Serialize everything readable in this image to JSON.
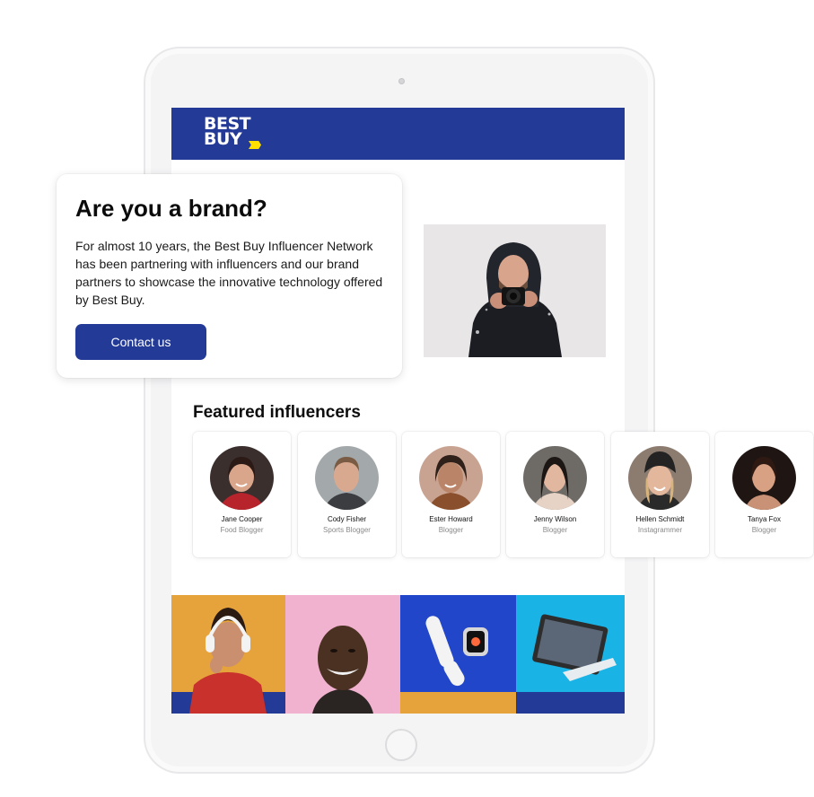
{
  "header": {
    "logo_line1": "BEST",
    "logo_line2": "BUY"
  },
  "brand_card": {
    "title": "Are you a brand?",
    "body": "For almost 10 years, the Best Buy Influencer Network has been partnering with influencers and our brand partners to showcase the innovative technology offered by Best Buy.",
    "button_label": "Contact us"
  },
  "featured": {
    "title": "Featured influencers",
    "influencers": [
      {
        "name": "Jane Cooper",
        "role": "Food Blogger"
      },
      {
        "name": "Cody Fisher",
        "role": "Sports Blogger"
      },
      {
        "name": "Ester Howard",
        "role": "Blogger"
      },
      {
        "name": "Jenny Wilson",
        "role": "Blogger"
      },
      {
        "name": "Hellen Schmidt",
        "role": "Instagrammer"
      },
      {
        "name": "Tanya Fox",
        "role": "Blogger"
      }
    ]
  },
  "colors": {
    "brand_blue": "#233a96",
    "logo_yellow": "#ffe000"
  }
}
